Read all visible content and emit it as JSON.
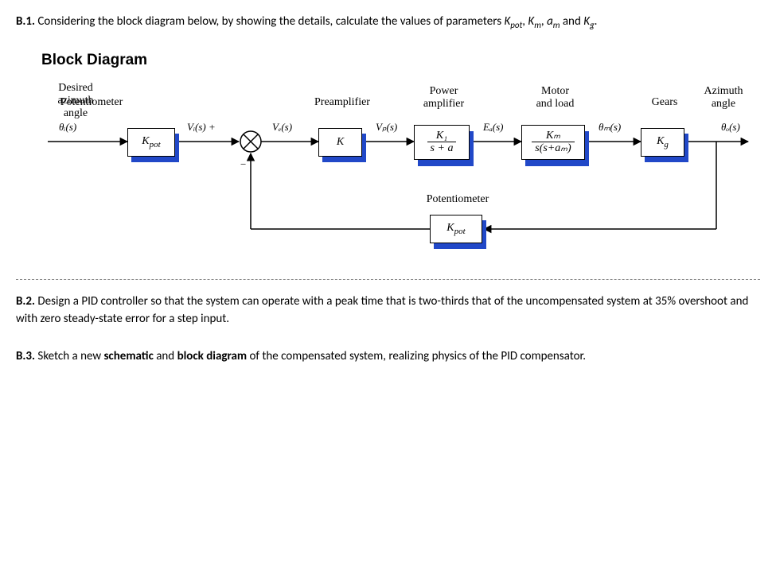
{
  "b1": {
    "label": "B.1.",
    "text_before": " Considering the block diagram below, by showing the details, calculate the values of parameters ",
    "params": [
      "K",
      "pot",
      ", ",
      "K",
      "m",
      ", ",
      "a",
      "m",
      " and ",
      "K",
      "g",
      "."
    ]
  },
  "heading": "Block Diagram",
  "diagram": {
    "labels": {
      "input": {
        "l1": "Desired",
        "l2": "azimuth",
        "l3": "angle"
      },
      "pot": "Potentiometer",
      "preamp": "Preamplifier",
      "power": {
        "l1": "Power",
        "l2": "amplifier"
      },
      "motor": {
        "l1": "Motor",
        "l2": "and load"
      },
      "gears": "Gears",
      "output": {
        "l1": "Azimuth",
        "l2": "angle"
      },
      "feedback": "Potentiometer"
    },
    "signals": {
      "theta_i": "θᵢ(s)",
      "Vi": "Vᵢ(s) +",
      "Ve": "Vₑ(s)",
      "Vp": "Vₚ(s)",
      "Ea": "Eₐ(s)",
      "theta_m": "θₘ(s)",
      "theta_o": "θₒ(s)",
      "minus": "−"
    },
    "blocks": {
      "kpot1": {
        "text": "K",
        "sub": "pot"
      },
      "K": "K",
      "power": {
        "num": "K₁",
        "den": "s + a"
      },
      "motor": {
        "num": "Kₘ",
        "den": "s(s+aₘ)"
      },
      "kg": {
        "text": "K",
        "sub": "g"
      },
      "kpot2": {
        "text": "K",
        "sub": "pot"
      }
    }
  },
  "b2": {
    "label": "B.2.",
    "text": " Design a PID controller so that the system can operate with a peak time that is two-thirds that of the uncompensated system at 35% overshoot and with zero steady-state error for a step input."
  },
  "b3": {
    "label": "B.3.",
    "t1": " Sketch a new ",
    "bold1": "schematic",
    "t2": " and ",
    "bold2": "block diagram",
    "t3": " of the compensated system, realizing physics of the PID compensator."
  }
}
